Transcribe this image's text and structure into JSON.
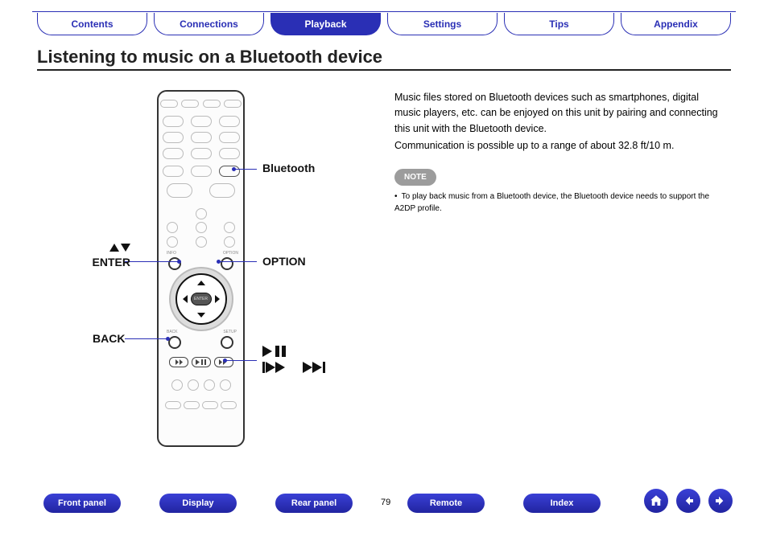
{
  "tabs": {
    "items": [
      {
        "label": "Contents",
        "active": false
      },
      {
        "label": "Connections",
        "active": false
      },
      {
        "label": "Playback",
        "active": true
      },
      {
        "label": "Settings",
        "active": false
      },
      {
        "label": "Tips",
        "active": false
      },
      {
        "label": "Appendix",
        "active": false
      }
    ]
  },
  "title": "Listening to music on a Bluetooth device",
  "body": {
    "p1": "Music files stored on Bluetooth devices such as smartphones, digital music players, etc. can be enjoyed on this unit by pairing and connecting this unit with the Bluetooth device.",
    "p2": "Communication is possible up to a range of about 32.8 ft/10 m.",
    "note_label": "NOTE",
    "note_text": "To play back music from a Bluetooth device, the Bluetooth device needs to support the A2DP profile."
  },
  "callouts": {
    "bluetooth": "Bluetooth",
    "enter": "ENTER",
    "option": "OPTION",
    "back": "BACK"
  },
  "page_number": "79",
  "bottom_nav": {
    "items": [
      "Front panel",
      "Display",
      "Rear panel",
      "Remote",
      "Index"
    ]
  },
  "nav_icons": {
    "home": "home-icon",
    "prev": "arrow-left-icon",
    "next": "arrow-right-icon"
  },
  "remote_center": "ENTER"
}
